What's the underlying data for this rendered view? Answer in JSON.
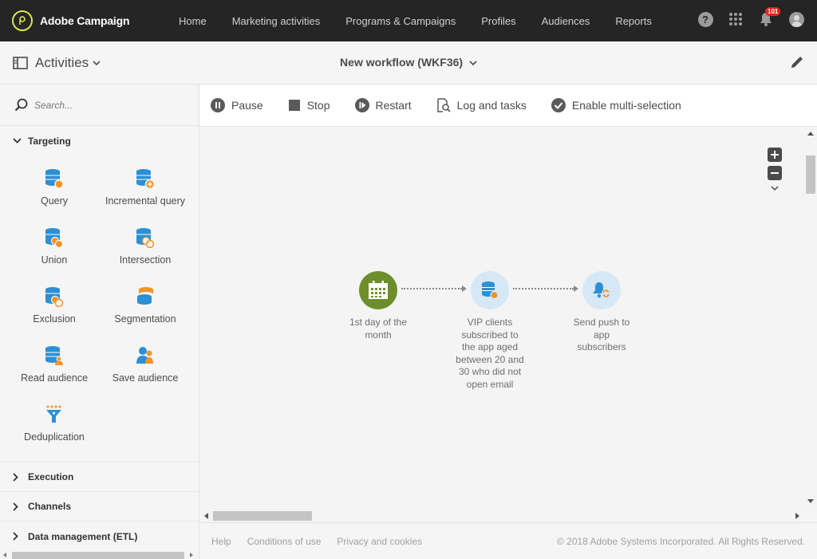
{
  "app": {
    "brand": "Adobe Campaign"
  },
  "nav": [
    "Home",
    "Marketing activities",
    "Programs & Campaigns",
    "Profiles",
    "Audiences",
    "Reports"
  ],
  "top_icons": {
    "help": "?",
    "notifications_count": "101"
  },
  "header": {
    "panel_title": "Activities",
    "workflow_title": "New workflow (WKF36)"
  },
  "search": {
    "placeholder": "Search..."
  },
  "sections": {
    "targeting": "Targeting",
    "execution": "Execution",
    "channels": "Channels",
    "data_management": "Data management (ETL)"
  },
  "targeting_items": [
    {
      "label": "Query",
      "icon": "query-icon"
    },
    {
      "label": "Incremental query",
      "icon": "incremental-query-icon"
    },
    {
      "label": "Union",
      "icon": "union-icon"
    },
    {
      "label": "Intersection",
      "icon": "intersection-icon"
    },
    {
      "label": "Exclusion",
      "icon": "exclusion-icon"
    },
    {
      "label": "Segmentation",
      "icon": "segmentation-icon"
    },
    {
      "label": "Read audience",
      "icon": "read-audience-icon"
    },
    {
      "label": "Save audience",
      "icon": "save-audience-icon"
    },
    {
      "label": "Deduplication",
      "icon": "deduplication-icon"
    }
  ],
  "toolbar": {
    "pause": "Pause",
    "stop": "Stop",
    "restart": "Restart",
    "log": "Log and tasks",
    "multi": "Enable multi-selection"
  },
  "workflow_nodes": [
    {
      "label": "1st day of the month",
      "color": "#6d8e2b"
    },
    {
      "label": "VIP clients subscribed to the app aged between 20 and 30 who did not open email",
      "color": "#d6e8f5"
    },
    {
      "label": "Send push to app subscribers",
      "color": "#d6e8f5"
    }
  ],
  "footer": {
    "help": "Help",
    "conditions": "Conditions of use",
    "privacy": "Privacy and cookies",
    "copyright": "© 2018 Adobe Systems Incorporated. All Rights Reserved."
  },
  "colors": {
    "accent_blue": "#2d8fd5",
    "accent_orange": "#f29423",
    "topbar": "#252525"
  }
}
